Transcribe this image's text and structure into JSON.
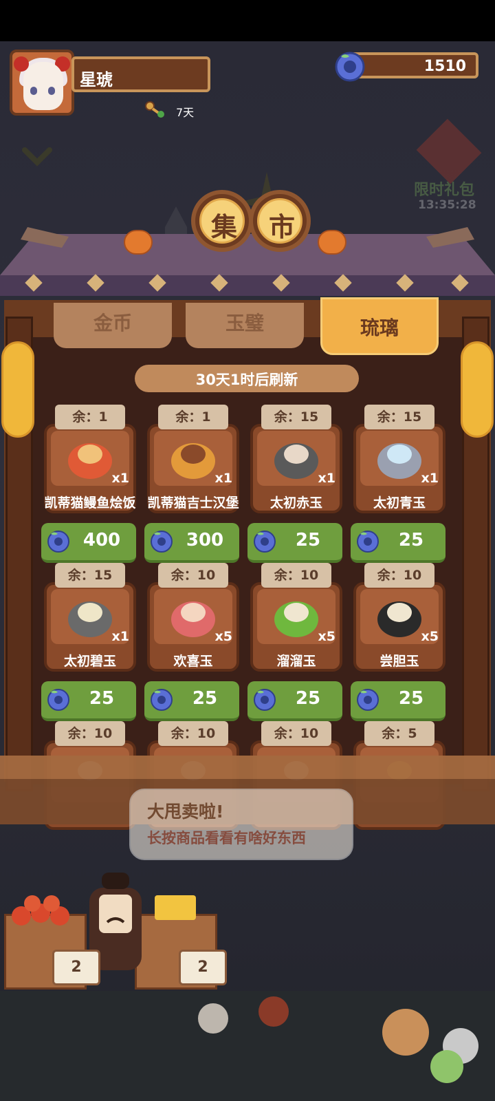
{
  "player": {
    "name": "星琥",
    "days_label": "7天",
    "currency": "1510"
  },
  "promo": {
    "label": "限时礼包",
    "timer": "13:35:28"
  },
  "shop": {
    "sign_chars": [
      "集",
      "市"
    ],
    "tabs": [
      {
        "label": "金币",
        "active": false
      },
      {
        "label": "玉璧",
        "active": false
      },
      {
        "label": "琉璃",
        "active": true
      }
    ],
    "refresh_text": "30天1时后刷新",
    "items": [
      {
        "stock": "余：1",
        "name": "凯蒂猫鳗鱼烩饭",
        "qty": "x1",
        "price": "400",
        "icon": "rice-bowl-icon"
      },
      {
        "stock": "余：1",
        "name": "凯蒂猫吉士汉堡",
        "qty": "x1",
        "price": "300",
        "icon": "burger-icon"
      },
      {
        "stock": "余：15",
        "name": "太初赤玉",
        "qty": "x1",
        "price": "25",
        "icon": "red-jade-icon"
      },
      {
        "stock": "余：15",
        "name": "太初青玉",
        "qty": "x1",
        "price": "25",
        "icon": "blue-jade-icon"
      },
      {
        "stock": "余：15",
        "name": "太初碧玉",
        "qty": "x1",
        "price": "25",
        "icon": "green-jade-icon"
      },
      {
        "stock": "余：10",
        "name": "欢喜玉",
        "qty": "x5",
        "price": "25",
        "icon": "red-disc-jade-icon"
      },
      {
        "stock": "余：10",
        "name": "溜溜玉",
        "qty": "x5",
        "price": "25",
        "icon": "green-disc-jade-icon"
      },
      {
        "stock": "余：10",
        "name": "尝胆玉",
        "qty": "x5",
        "price": "25",
        "icon": "black-disc-jade-icon"
      },
      {
        "stock": "余：10",
        "name": "",
        "qty": "",
        "price": "",
        "icon": "disc-jade-icon"
      },
      {
        "stock": "余：10",
        "name": "",
        "qty": "",
        "price": "",
        "icon": "disc-jade-icon"
      },
      {
        "stock": "余：10",
        "name": "",
        "qty": "",
        "price": "",
        "icon": "disc-jade-icon"
      },
      {
        "stock": "余：5",
        "name": "",
        "qty": "",
        "price": "",
        "icon": "item-icon"
      }
    ]
  },
  "speech": {
    "line1": "大甩卖啦!",
    "line2": "长按商品看看有啥好东西"
  },
  "stalls": {
    "tag_left": "2",
    "tag_right": "2"
  },
  "colors": {
    "wood_dark": "#3b2018",
    "wood": "#6b3b20",
    "gold_tab": "#f2b049",
    "price_green": "#6f9e3e",
    "roof_purple": "#6e5670"
  }
}
